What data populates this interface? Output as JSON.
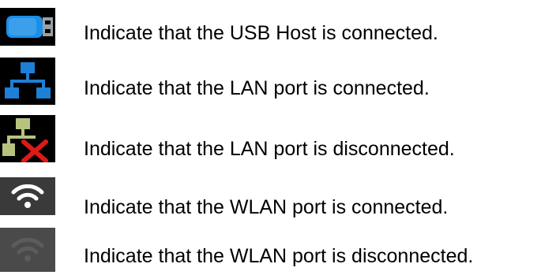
{
  "legend": {
    "items": [
      {
        "icon": "usb-host-icon",
        "text": "Indicate that the USB Host is connected."
      },
      {
        "icon": "lan-connected-icon",
        "text": "Indicate that the LAN port is connected."
      },
      {
        "icon": "lan-disconnected-icon",
        "text": "Indicate that the LAN port is disconnected."
      },
      {
        "icon": "wlan-connected-icon",
        "text": "Indicate that the WLAN port is connected."
      },
      {
        "icon": "wlan-disconnected-icon",
        "text": "Indicate that the WLAN port is disconnected."
      }
    ]
  },
  "colors": {
    "icon_background": "#000000",
    "usb_blue": "#1a8fe8",
    "lan_blue": "#1e7fd6",
    "lan_disconnected_green": "#b7c27f",
    "disconnect_red": "#e01818",
    "wlan_connected_bg": "#3a3a3a",
    "wlan_connected_fg": "#ffffff",
    "wlan_disconnected_bg": "#4a4a4a",
    "wlan_disconnected_fg": "#5c5c5c"
  }
}
